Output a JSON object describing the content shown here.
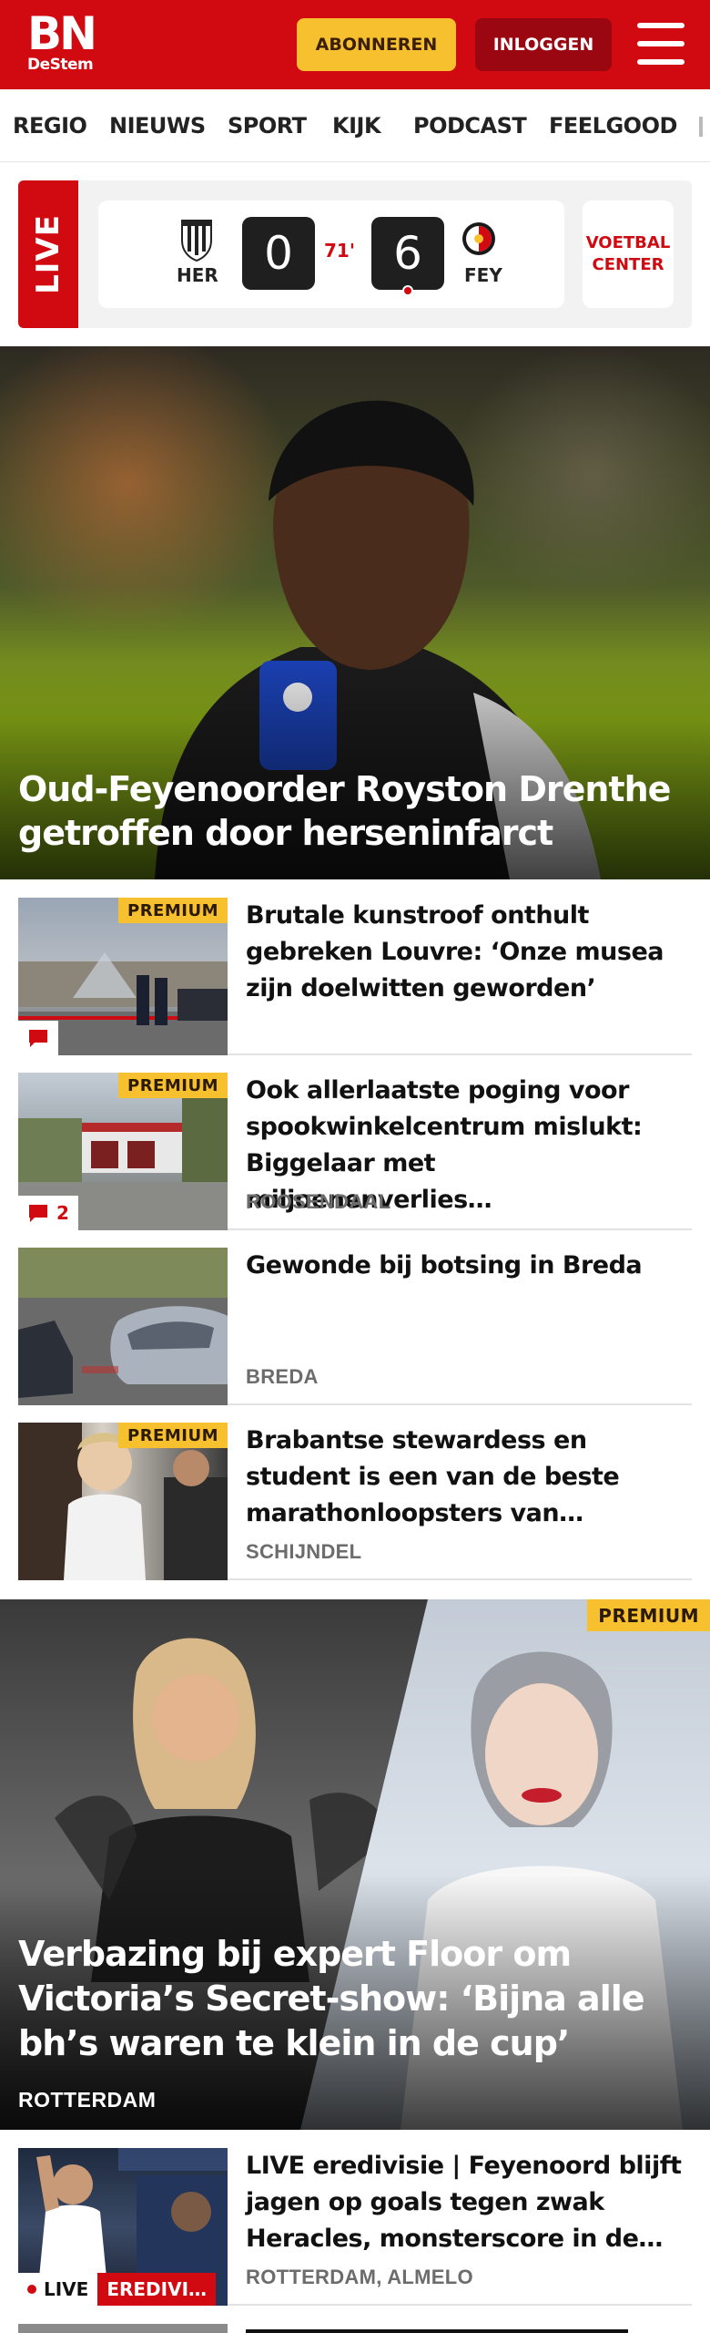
{
  "header": {
    "logo_main": "BN",
    "logo_sub": "DeStem",
    "subscribe_label": "ABONNEREN",
    "login_label": "INLOGGEN",
    "menu_icon": "hamburger-menu-icon",
    "brand_color": "#d10a11",
    "accent_color": "#f7c02e"
  },
  "nav": {
    "items": [
      "REGIO",
      "NIEUWS",
      "SPORT",
      "KIJK",
      "PODCAST",
      "FEELGOOD"
    ]
  },
  "live_score": {
    "tag": "LIVE",
    "home_team": "HER",
    "away_team": "FEY",
    "home_score": "0",
    "away_score": "6",
    "minute": "71'",
    "voetbal_center_label": "VOETBAL CENTER"
  },
  "hero": {
    "title": "Oud-Feyenoorder Royston Drenthe getroffen door herseninfarct"
  },
  "articles": [
    {
      "title": "Brutale kunstroof onthult gebreken Louvre: ‘Onze musea zijn doelwitten geworden’",
      "premium": "PREMIUM",
      "location": "",
      "comments": ""
    },
    {
      "title": "Ook allerlaatste poging voor spookwinkelcentrum mislukt: Biggelaar met miljoenenverlies…",
      "premium": "PREMIUM",
      "location": "ROOSENDAAL",
      "comments": "2"
    },
    {
      "title": "Gewonde bij botsing in Breda",
      "premium": "",
      "location": "BREDA",
      "comments": ""
    },
    {
      "title": "Brabantse stewardess en student is een van de beste marathonloopsters van…",
      "premium": "PREMIUM",
      "location": "SCHIJNDEL",
      "comments": ""
    }
  ],
  "feature": {
    "premium": "PREMIUM",
    "title": "Verbazing bij expert Floor om Victoria’s Secret-show: ‘Bijna alle bh’s waren te klein in de cup’",
    "location": "ROTTERDAM"
  },
  "live_article": {
    "title": "LIVE eredivisie | Feyenoord blijft jagen op goals tegen zwak Heracles, monsterscore in de…",
    "location": "ROTTERDAM, ALMELO",
    "live_label": "LIVE",
    "category_label": "EREDIVI…"
  }
}
